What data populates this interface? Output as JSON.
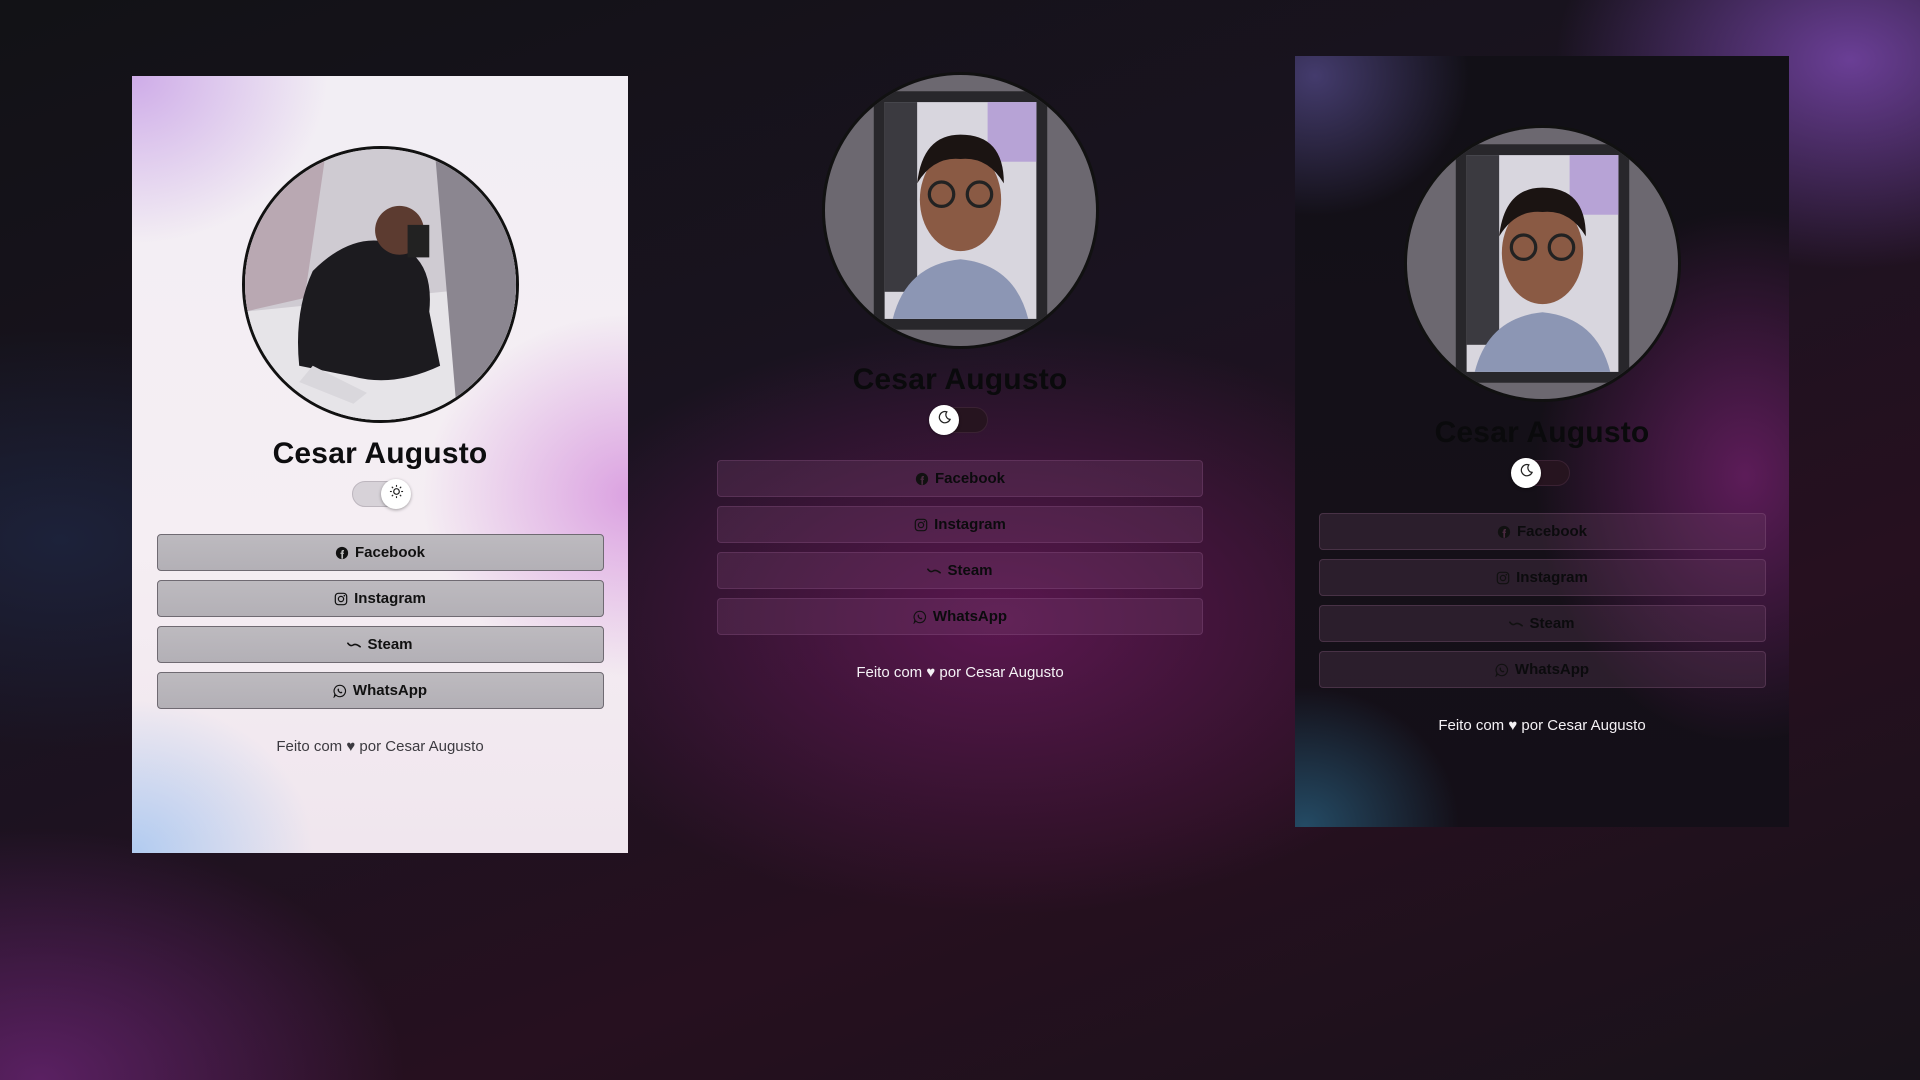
{
  "cards": [
    {
      "id": "light",
      "theme": "light",
      "name": "Cesar Augusto",
      "toggle_icon": "sun-icon",
      "links": [
        {
          "label": "Facebook",
          "icon": "facebook-icon"
        },
        {
          "label": "Instagram",
          "icon": "instagram-icon"
        },
        {
          "label": "Steam",
          "icon": "steam-icon"
        },
        {
          "label": "WhatsApp",
          "icon": "whatsapp-icon"
        }
      ],
      "footer": "Feito com ♥ por Cesar Augusto"
    },
    {
      "id": "center",
      "theme": "dark",
      "name": "Cesar Augusto",
      "toggle_icon": "moon-icon",
      "links": [
        {
          "label": "Facebook",
          "icon": "facebook-icon"
        },
        {
          "label": "Instagram",
          "icon": "instagram-icon"
        },
        {
          "label": "Steam",
          "icon": "steam-icon"
        },
        {
          "label": "WhatsApp",
          "icon": "whatsapp-icon"
        }
      ],
      "footer": "Feito com ♥ por Cesar Augusto"
    },
    {
      "id": "right",
      "theme": "dark",
      "name": "Cesar Augusto",
      "toggle_icon": "moon-icon",
      "links": [
        {
          "label": "Facebook",
          "icon": "facebook-icon"
        },
        {
          "label": "Instagram",
          "icon": "instagram-icon"
        },
        {
          "label": "Steam",
          "icon": "steam-icon"
        },
        {
          "label": "WhatsApp",
          "icon": "whatsapp-icon"
        }
      ],
      "footer": "Feito com ♥ por Cesar Augusto"
    }
  ],
  "colors": {
    "page_background": "#1a1320",
    "accent_purple": "#6e195f",
    "light_card": "#f2eef4",
    "light_button": "#b3b0b6",
    "dark_card": "#151018",
    "text_dark": "#0a0a0c",
    "text_light": "#f4f1f5"
  }
}
